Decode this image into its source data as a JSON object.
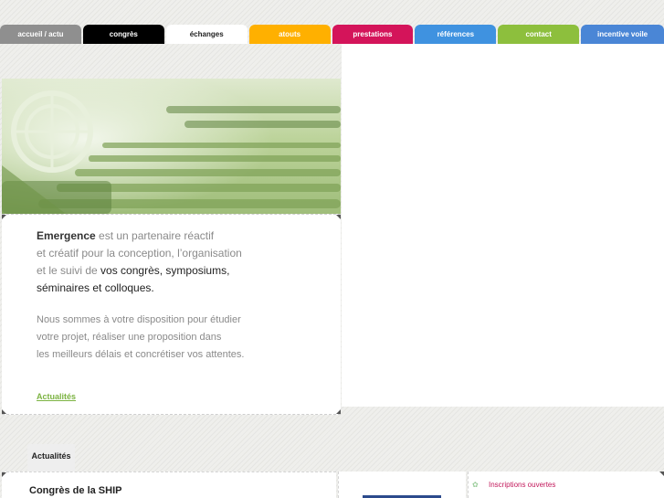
{
  "nav": {
    "tabs": [
      {
        "label": "accueil / actu",
        "bg": "#8f8f8f",
        "fg": "#ffffff"
      },
      {
        "label": "congrès",
        "bg": "#000000",
        "fg": "#ffffff"
      },
      {
        "label": "échanges",
        "bg": "#ffffff",
        "fg": "#222222"
      },
      {
        "label": "atouts",
        "bg": "#ffb000",
        "fg": "#ffffff"
      },
      {
        "label": "prestations",
        "bg": "#d4145a",
        "fg": "#ffffff"
      },
      {
        "label": "références",
        "bg": "#3f92e0",
        "fg": "#ffffff"
      },
      {
        "label": "contact",
        "bg": "#8dbf3d",
        "fg": "#ffffff"
      },
      {
        "label": "incentive voile",
        "bg": "#4a86d6",
        "fg": "#ffffff"
      }
    ]
  },
  "intro": {
    "brand": "Emergence",
    "text1": " est un partenaire réactif",
    "text2": "et créatif pour la conception, l’organisation",
    "text3": "et le suivi de ",
    "dark1": "vos congrès, symposiums,",
    "dark2": "séminaires et colloques."
  },
  "dispo": {
    "line1": "Nous sommes à votre disposition pour étudier",
    "line2": "votre projet, réaliser une proposition dans",
    "line3": "les meilleurs délais et concrétiser vos attentes."
  },
  "actualites_link": "Actualités",
  "section_tab": "Actualités",
  "lower": {
    "title": "Congrès de la SHIP"
  },
  "right_card": {
    "icon": "leaf-icon",
    "text": "Inscriptions ouvertes"
  },
  "colors": {
    "link_green": "#7cb342",
    "inscription_pink": "#c2185b"
  }
}
